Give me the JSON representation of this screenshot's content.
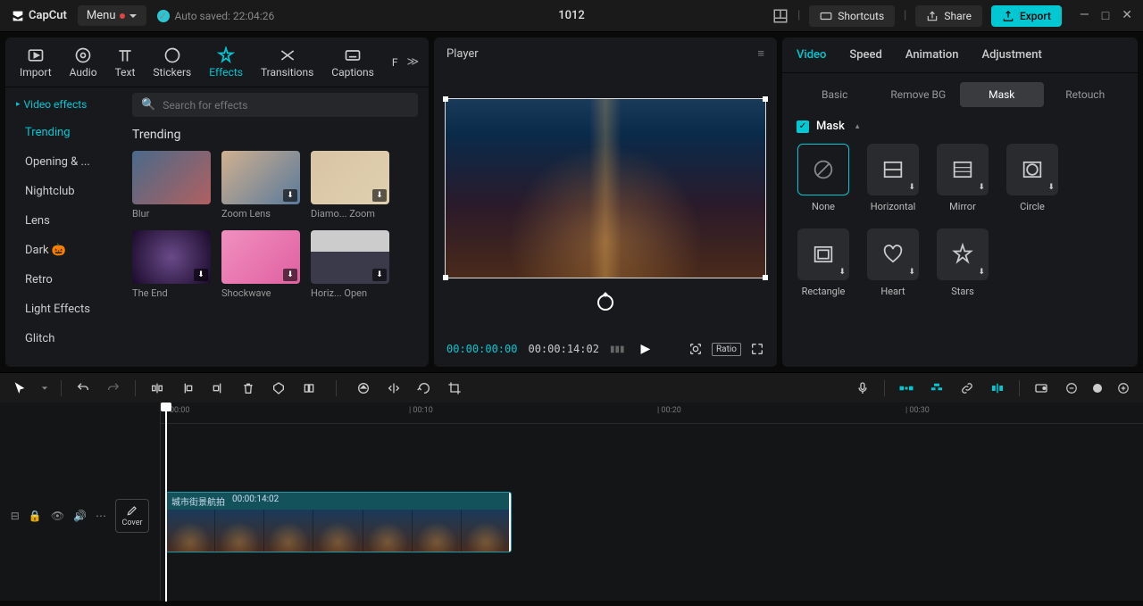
{
  "app": {
    "name": "CapCut",
    "menu_label": "Menu",
    "autosave": "Auto saved: 22:04:26",
    "project_name": "1012"
  },
  "topbar": {
    "shortcuts": "Shortcuts",
    "share": "Share",
    "export": "Export"
  },
  "media_tabs": {
    "import": "Import",
    "audio": "Audio",
    "text": "Text",
    "stickers": "Stickers",
    "effects": "Effects",
    "transitions": "Transitions",
    "captions": "Captions",
    "more": "F"
  },
  "effects": {
    "sidebar_title": "Video effects",
    "categories": [
      "Trending",
      "Opening & ...",
      "Nightclub",
      "Lens",
      "Dark 🎃",
      "Retro",
      "Light Effects",
      "Glitch"
    ],
    "active_category": "Trending",
    "search_placeholder": "Search for effects",
    "section": "Trending",
    "items": [
      {
        "name": "Blur",
        "class": "blur",
        "dl": false
      },
      {
        "name": "Zoom Lens",
        "class": "zoom",
        "dl": true
      },
      {
        "name": "Diamo... Zoom",
        "class": "diamond",
        "dl": true
      },
      {
        "name": "The End",
        "class": "end",
        "dl": true
      },
      {
        "name": "Shockwave",
        "class": "shockwave",
        "dl": true
      },
      {
        "name": "Horiz... Open",
        "class": "horizon",
        "dl": true
      }
    ]
  },
  "player": {
    "title": "Player",
    "time_current": "00:00:00:00",
    "time_total": "00:00:14:02",
    "ratio": "Ratio"
  },
  "props": {
    "tabs": [
      "Video",
      "Speed",
      "Animation",
      "Adjustment"
    ],
    "active_tab": "Video",
    "subtabs": [
      "Basic",
      "Remove BG",
      "Mask",
      "Retouch"
    ],
    "active_subtab": "Mask",
    "mask_section": "Mask",
    "masks": [
      {
        "name": "None",
        "active": true,
        "dl": false
      },
      {
        "name": "Horizontal",
        "dl": true
      },
      {
        "name": "Mirror",
        "dl": true
      },
      {
        "name": "Circle",
        "dl": true
      },
      {
        "name": "Rectangle",
        "dl": true
      },
      {
        "name": "Heart",
        "dl": true
      },
      {
        "name": "Stars",
        "dl": true
      }
    ]
  },
  "timeline": {
    "ruler": [
      "00:00",
      "| 00:10",
      "| 00:20",
      "| 00:30"
    ],
    "cover": "Cover",
    "clip_name": "城市街景航拍",
    "clip_duration": "00:00:14:02"
  }
}
